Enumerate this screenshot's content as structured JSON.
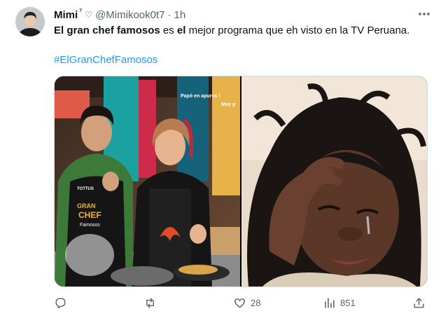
{
  "author": {
    "display_name": "Mimi",
    "name_suffix": "⁷",
    "heart_emoji": "♡",
    "handle": "@Mimikook0t7",
    "separator": "·",
    "time": "1h"
  },
  "tweet": {
    "text_bold_1": "El gran chef famosos",
    "text_plain_1": " es ",
    "text_bold_2": "el",
    "text_plain_2": " mejor programa que eh visto en la TV Peruana.",
    "hashtag": "#ElGranChefFamosos"
  },
  "media": {
    "left_photo_overlay_1": "Papó en apuros l",
    "left_photo_overlay_2": "Muy p",
    "apron_logo_1": "TOTTUS",
    "apron_logo_2": "GRAN",
    "apron_logo_3": "CHEF",
    "apron_logo_4": "Famosos"
  },
  "actions": {
    "reply_count": "",
    "retweet_count": "",
    "like_count": "28",
    "views_count": "851"
  },
  "icons": {
    "more": "more-icon",
    "reply": "reply-icon",
    "retweet": "retweet-icon",
    "like": "heart-icon",
    "views": "views-icon",
    "share": "share-icon"
  },
  "colors": {
    "text": "#0f1419",
    "secondary": "#536471",
    "link": "#1d9bf0",
    "border": "#cfd9de"
  }
}
